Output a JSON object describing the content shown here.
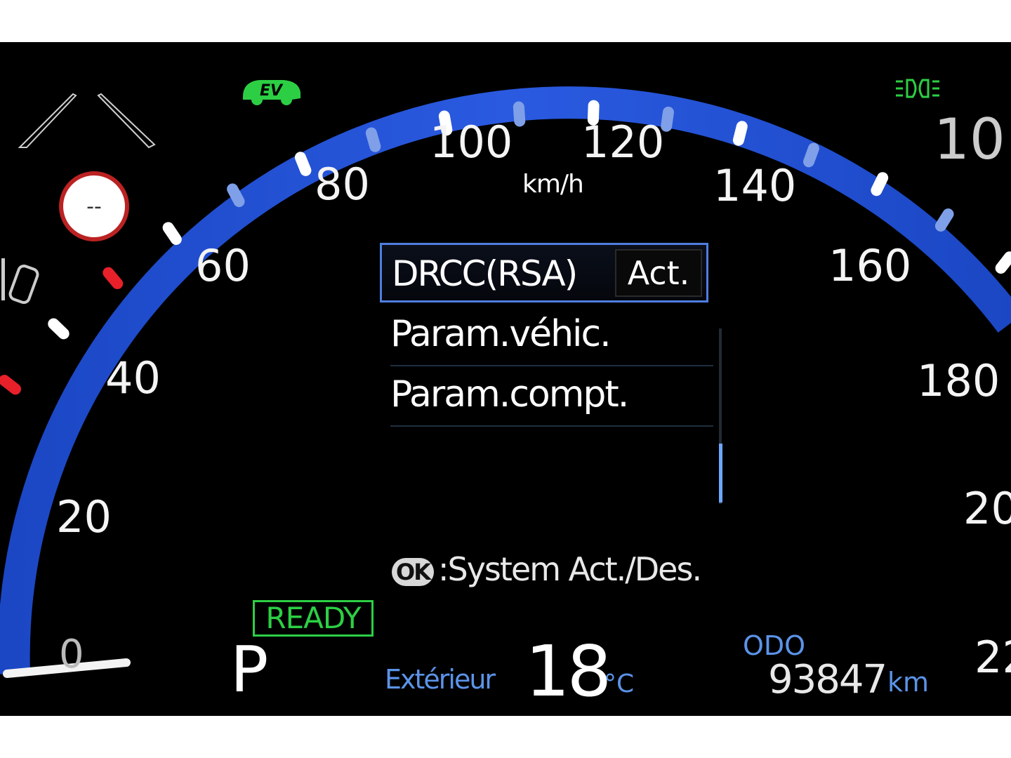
{
  "speedometer": {
    "unit": "km/h",
    "labels": [
      "0",
      "20",
      "40",
      "60",
      "80",
      "100",
      "120",
      "140",
      "160",
      "180"
    ],
    "right_labels": [
      "10",
      "20",
      "22"
    ]
  },
  "indicators": {
    "ev": "EV",
    "ready": "READY",
    "speed_limit_sign": "--",
    "headlight_icon": "headlight-icon",
    "lane_icon": "lane-icon"
  },
  "menu": {
    "selected_item": "DRCC(RSA)",
    "selected_state": "Act.",
    "items": [
      "Param.véhic.",
      "Param.compt."
    ],
    "hint_button": "OK",
    "hint_text": ":System Act./Des."
  },
  "status": {
    "gear": "P",
    "exterior_label": "Extérieur",
    "temperature": "18",
    "temperature_unit": "°C",
    "odo_label": "ODO",
    "odo_value": "93847",
    "odo_unit": "km"
  },
  "colors": {
    "ring": "#1f4fd1",
    "ready": "#2ccf44",
    "accent_blue": "#5b93e8",
    "warning_tick": "#e8202a"
  }
}
